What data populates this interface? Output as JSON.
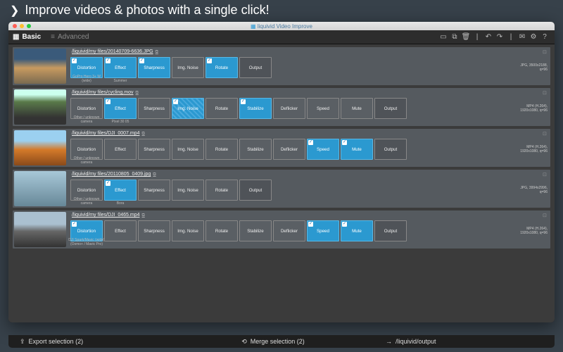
{
  "promo": {
    "headline": "Improve videos & photos with a single click!"
  },
  "window": {
    "title": "liquivid Video Improve"
  },
  "toolbar": {
    "basic": "Basic",
    "advanced": "Advanced"
  },
  "tracks": [
    {
      "thumb": "sunset",
      "path": "/liquivid/my files/20140709-6636.JPG",
      "camera": "GoPro Hero 3+ W (wide)",
      "nodes": [
        {
          "label": "Distortion",
          "active": true,
          "checked": true,
          "sub": ""
        },
        {
          "label": "Effect",
          "active": true,
          "checked": true,
          "sub": "Summer"
        },
        {
          "label": "Sharpness",
          "active": true,
          "checked": true,
          "sub": ""
        },
        {
          "label": "Img. Noise",
          "active": false,
          "checked": false,
          "sub": ""
        },
        {
          "label": "Rotate",
          "active": true,
          "checked": true,
          "sub": ""
        },
        {
          "label": "Output",
          "active": false,
          "checked": false,
          "sub": ""
        }
      ],
      "meta": "JPG, 3500x2188,\nq=96"
    },
    {
      "thumb": "forest",
      "path": "/liquivid/my files/cycling.mov",
      "camera": "Other / unknown camera",
      "nodes": [
        {
          "label": "Distortion",
          "active": false,
          "checked": false,
          "sub": ""
        },
        {
          "label": "Effect",
          "active": true,
          "checked": true,
          "sub": "Pixel 30 05"
        },
        {
          "label": "Sharpness",
          "active": false,
          "checked": false,
          "sub": ""
        },
        {
          "label": "Img. Noise",
          "active": true,
          "checked": true,
          "sub": "",
          "hatch": true
        },
        {
          "label": "Rotate",
          "active": false,
          "checked": false,
          "sub": ""
        },
        {
          "label": "Stabilize",
          "active": true,
          "checked": true,
          "sub": ""
        },
        {
          "label": "Deflicker",
          "active": false,
          "checked": false,
          "sub": ""
        },
        {
          "label": "Speed",
          "active": false,
          "checked": false,
          "sub": ""
        },
        {
          "label": "Mute",
          "active": false,
          "checked": false,
          "sub": ""
        },
        {
          "label": "Output",
          "active": false,
          "checked": false,
          "sub": ""
        }
      ],
      "meta": "MP4 (H.264),\n1920x1080, q=96"
    },
    {
      "thumb": "autumn",
      "path": "/liquivid/my files/DJI_0007.mp4",
      "camera": "Other / unknown camera",
      "nodes": [
        {
          "label": "Distortion",
          "active": false,
          "checked": false,
          "sub": ""
        },
        {
          "label": "Effect",
          "active": false,
          "checked": false,
          "sub": ""
        },
        {
          "label": "Sharpness",
          "active": false,
          "checked": false,
          "sub": ""
        },
        {
          "label": "Img. Noise",
          "active": false,
          "checked": false,
          "sub": ""
        },
        {
          "label": "Rotate",
          "active": false,
          "checked": false,
          "sub": ""
        },
        {
          "label": "Stabilize",
          "active": false,
          "checked": false,
          "sub": ""
        },
        {
          "label": "Deflicker",
          "active": false,
          "checked": false,
          "sub": ""
        },
        {
          "label": "Speed",
          "active": true,
          "checked": true,
          "sub": ""
        },
        {
          "label": "Mute",
          "active": true,
          "checked": true,
          "sub": ""
        },
        {
          "label": "Output",
          "active": false,
          "checked": false,
          "sub": ""
        }
      ],
      "meta": "MP4 (H.264),\n1920x1080, q=96"
    },
    {
      "thumb": "action",
      "path": "/liquivid/my files/20110805_0409.jpg",
      "camera": "Other / unknown camera",
      "nodes": [
        {
          "label": "Distortion",
          "active": false,
          "checked": false,
          "sub": ""
        },
        {
          "label": "Effect",
          "active": true,
          "checked": true,
          "sub": "Bora"
        },
        {
          "label": "Sharpness",
          "active": false,
          "checked": false,
          "sub": ""
        },
        {
          "label": "Img. Noise",
          "active": false,
          "checked": false,
          "sub": ""
        },
        {
          "label": "Rotate",
          "active": false,
          "checked": false,
          "sub": ""
        },
        {
          "label": "Output",
          "active": false,
          "checked": false,
          "sub": ""
        }
      ],
      "meta": "JPG, 3994x2996,\nq=96"
    },
    {
      "thumb": "road",
      "path": "/liquivid/my files/DJI_0465.mp4",
      "camera": "DJI Spark/Mavic (wide) (Osmo+ / Mavic Pro)",
      "nodes": [
        {
          "label": "Distortion",
          "active": true,
          "checked": true,
          "sub": ""
        },
        {
          "label": "Effect",
          "active": false,
          "checked": false,
          "sub": ""
        },
        {
          "label": "Sharpness",
          "active": false,
          "checked": false,
          "sub": ""
        },
        {
          "label": "Img. Noise",
          "active": false,
          "checked": false,
          "sub": ""
        },
        {
          "label": "Rotate",
          "active": false,
          "checked": false,
          "sub": ""
        },
        {
          "label": "Stabilize",
          "active": false,
          "checked": false,
          "sub": ""
        },
        {
          "label": "Deflicker",
          "active": false,
          "checked": false,
          "sub": ""
        },
        {
          "label": "Speed",
          "active": true,
          "checked": true,
          "sub": ""
        },
        {
          "label": "Mute",
          "active": true,
          "checked": true,
          "sub": ""
        },
        {
          "label": "Output",
          "active": false,
          "checked": false,
          "sub": ""
        }
      ],
      "meta": "MP4 (H.264),\n1920x1080, q=96"
    }
  ],
  "footer": {
    "export": "Export selection (2)",
    "merge": "Merge selection (2)",
    "output": "/liquivid/output"
  }
}
